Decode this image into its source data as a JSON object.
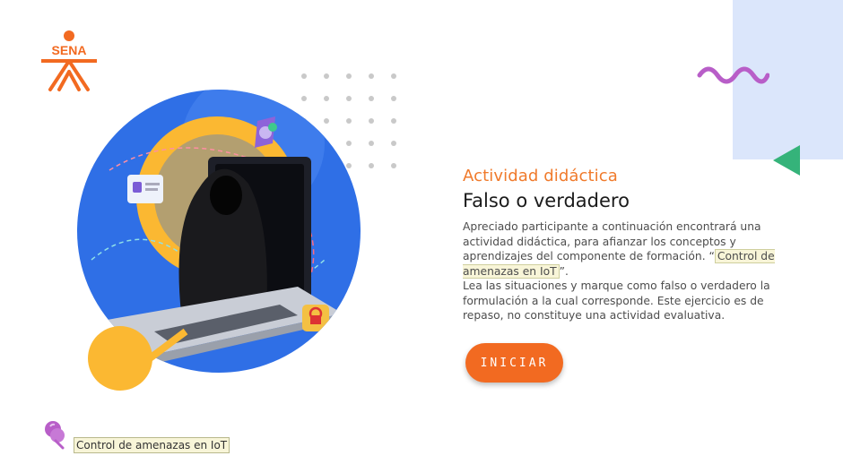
{
  "logo": {
    "text": "SENA",
    "color": "#f26a21"
  },
  "activity": {
    "kicker": "Actividad didáctica",
    "title": "Falso o verdadero",
    "paragraph1_before": "Apreciado participante a continuación encontrará una actividad didáctica, para afianzar los conceptos y aprendizajes del componente de formación. “",
    "paragraph1_highlight": "Control de amenazas en IoT",
    "paragraph1_after": "”.",
    "paragraph2": "Lea las situaciones y marque como falso o verdadero la formulación a la cual corresponde.  Este ejercicio es de repaso, no constituye una actividad evaluativa.",
    "start_label": "INICIAR"
  },
  "footer": {
    "course_tag": "Control de amenazas en IoT",
    "pin_icon": "pin-icon"
  },
  "colors": {
    "accent": "#f26a21",
    "title_orange": "#f07a2b",
    "panel": "#dbe6fb",
    "wave": "#b85ec8",
    "triangle": "#35b37a"
  }
}
